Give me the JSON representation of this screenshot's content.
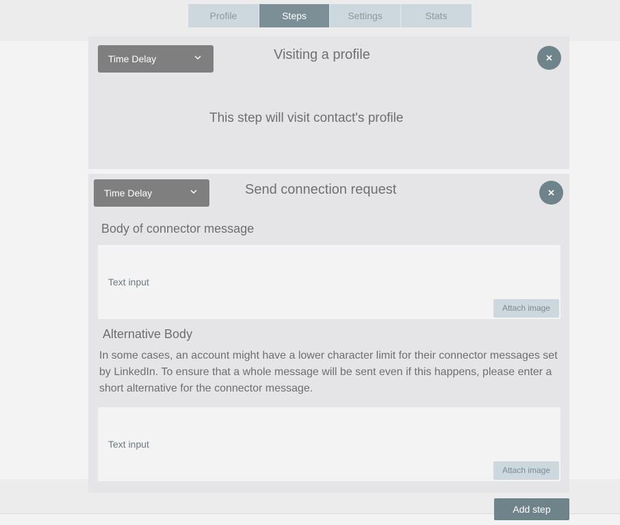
{
  "tabs": [
    {
      "label": "Profile"
    },
    {
      "label": "Steps"
    },
    {
      "label": "Settings"
    },
    {
      "label": "Stats"
    }
  ],
  "active_tab": "Steps",
  "steps": [
    {
      "dropdown_value": "Time Delay",
      "title": "Visiting a profile",
      "description": "This step will visit contact's profile"
    },
    {
      "dropdown_value": "Time Delay",
      "title": "Send connection request",
      "body_label": "Body of connector message",
      "body_placeholder": "Text input",
      "attach_label": "Attach image",
      "alt_label": "Alternative Body",
      "alt_description": "In some cases, an account might have a lower character limit for their connector messages set by LinkedIn. To ensure that a whole message will be sent even if this happens, please enter a short alternative for the connector message.",
      "alt_placeholder": "Text input",
      "alt_attach_label": "Attach image"
    }
  ],
  "add_step_label": "Add step",
  "colors": {
    "accent": "#6f838b",
    "tab_active": "#7c8e96",
    "tab_inactive": "#cdd8de",
    "dropdown": "#7f7f7f",
    "card": "#e5e5e7"
  },
  "icons": {
    "dropdown": "chevron-down-icon",
    "close": "close-icon"
  }
}
